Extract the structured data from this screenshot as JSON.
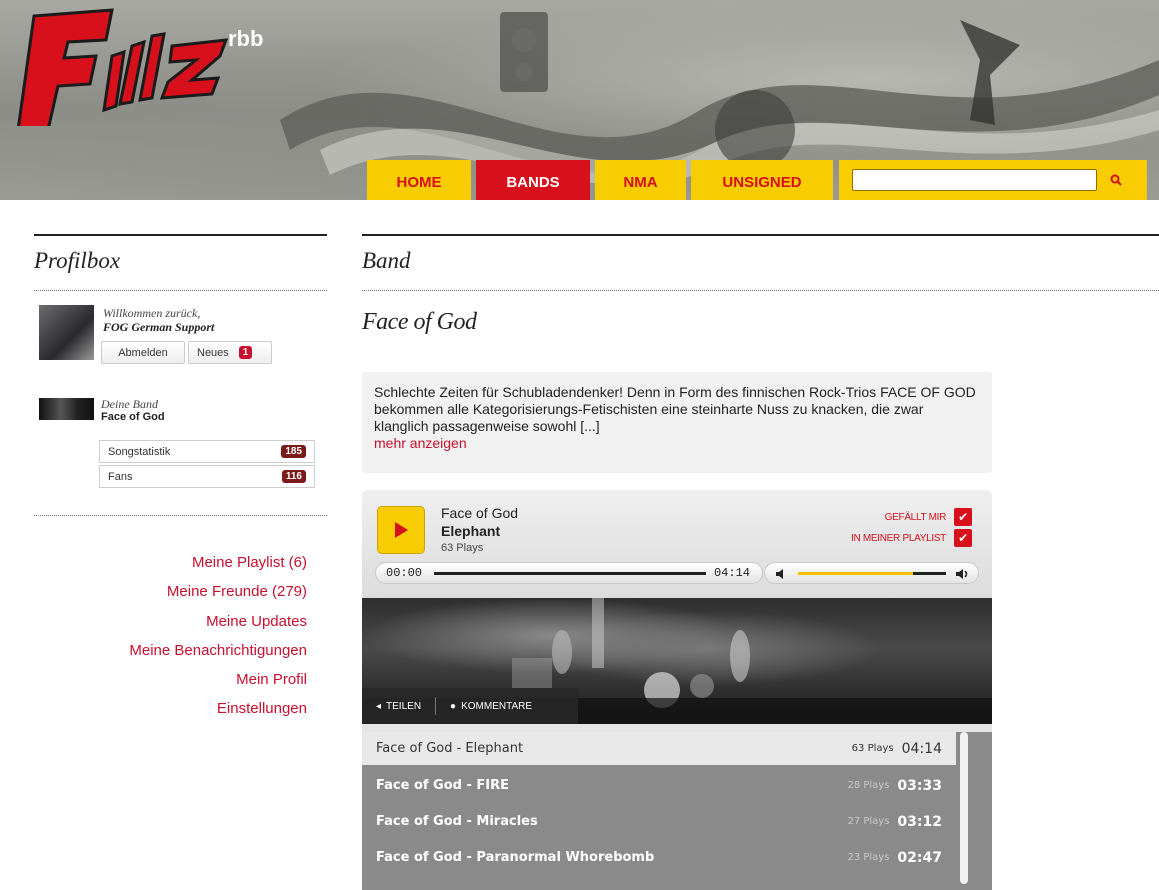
{
  "header": {
    "logo_text": "rbb",
    "nav": [
      {
        "label": "HOME",
        "active": false
      },
      {
        "label": "BANDS",
        "active": true
      },
      {
        "label": "NMA",
        "active": false
      },
      {
        "label": "UNSIGNED",
        "active": false
      }
    ],
    "search": {
      "placeholder": "",
      "icon": "search-icon"
    }
  },
  "sidebar": {
    "title": "Profilbox",
    "welcome": "Willkommen zurück,",
    "user_name": "FOG German Support",
    "logout_label": "Abmelden",
    "news_label": "Neues",
    "news_count": "1",
    "band_caption": "Deine Band",
    "band_name": "Face of God",
    "stats": [
      {
        "label": "Songstatistik",
        "count": "185"
      },
      {
        "label": "Fans",
        "count": "116"
      }
    ],
    "links": [
      "Meine Playlist (6)",
      "Meine Freunde (279)",
      "Meine Updates",
      "Meine Benachrichtigungen",
      "Mein Profil",
      "Einstellungen"
    ]
  },
  "main": {
    "section_title": "Band",
    "band_name": "Face of God",
    "description": "Schlechte Zeiten für Schubladendenker! Denn in Form des finnischen Rock-Trios FACE OF GOD bekommen alle Kategorisierungs-Fetischisten eine steinharte Nuss zu knacken, die zwar klanglich passagenweise sowohl [...]",
    "more_label": "mehr anzeigen"
  },
  "player": {
    "artist": "Face of God",
    "title": "Elephant",
    "plays": "63 Plays",
    "like_label": "GEFÄLLT MIR",
    "playlist_label": "IN MEINER PLAYLIST",
    "time_current": "00:00",
    "time_total": "04:14",
    "progress": 0,
    "volume": 0.78,
    "share_label": "TEILEN",
    "comments_label": "KOMMENTARE",
    "tracks": [
      {
        "name": "Face of God - Elephant",
        "plays": "63 Plays",
        "duration": "04:14",
        "active": true
      },
      {
        "name": "Face of God - FIRE",
        "plays": "28 Plays",
        "duration": "03:33",
        "active": false
      },
      {
        "name": "Face of God - Miracles",
        "plays": "27 Plays",
        "duration": "03:12",
        "active": false
      },
      {
        "name": "Face of God - Paranormal Whorebomb",
        "plays": "23 Plays",
        "duration": "02:47",
        "active": false
      }
    ]
  },
  "colors": {
    "accent": "#d8101c",
    "yellow": "#f7cc00"
  }
}
